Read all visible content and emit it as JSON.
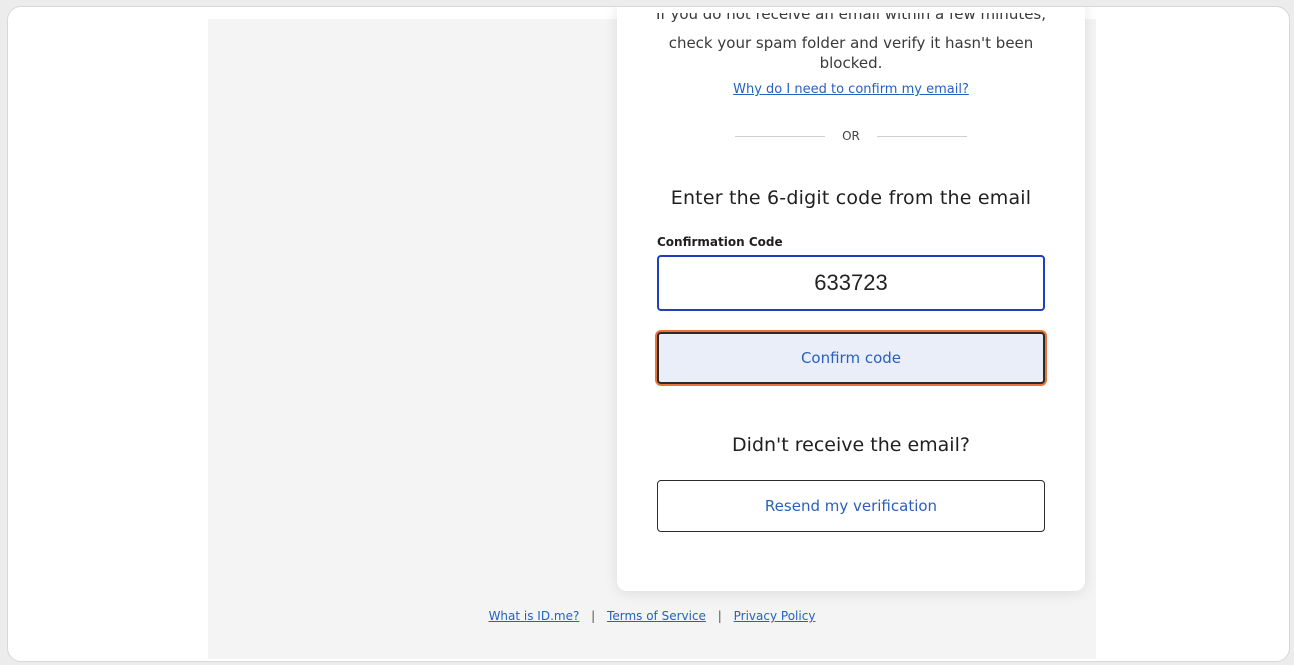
{
  "card": {
    "cut_text": "If you do not receive an email within a few minutes,",
    "info_text": "check your spam folder and verify it hasn't been blocked.",
    "why_link": "Why do I need to confirm my email?",
    "divider_text": "OR",
    "code_heading": "Enter the 6-digit code from the email",
    "code_label": "Confirmation Code",
    "code_value": "633723",
    "confirm_label": "Confirm code",
    "resend_heading": "Didn't receive the email?",
    "resend_label": "Resend my verification"
  },
  "footer": {
    "links": [
      "What is ID.me?",
      "Terms of Service",
      "Privacy Policy"
    ],
    "separator": "|"
  },
  "colors": {
    "link": "#2462c2",
    "input_border": "#1f3fbf",
    "focus_ring": "#e8743c",
    "confirm_bg": "#e9eef8"
  }
}
